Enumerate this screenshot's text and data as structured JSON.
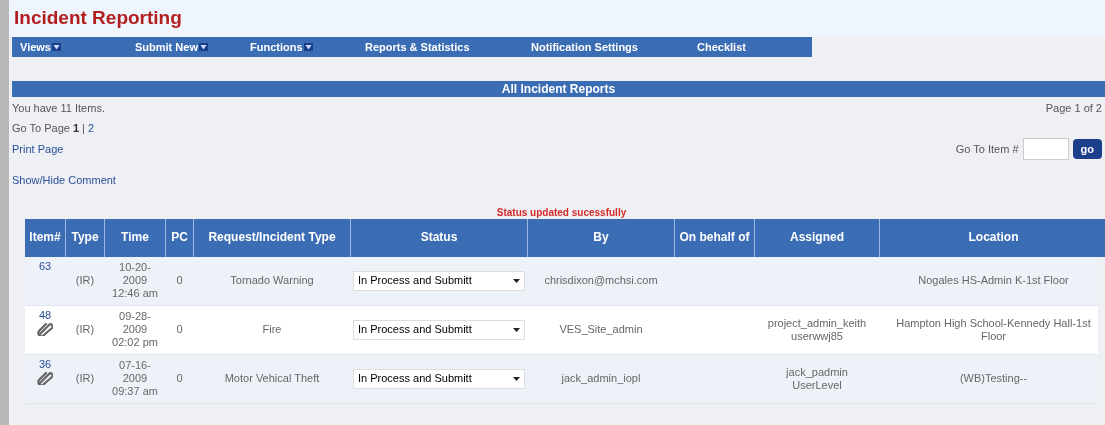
{
  "title": "Incident Reporting",
  "menu": [
    {
      "label": "Views",
      "dropdown": true
    },
    {
      "label": "Submit New",
      "dropdown": true
    },
    {
      "label": "Functions",
      "dropdown": true
    },
    {
      "label": "Reports & Statistics",
      "dropdown": false
    },
    {
      "label": "Notification Settings",
      "dropdown": false
    },
    {
      "label": "Checklist",
      "dropdown": false
    }
  ],
  "section_title": "All Incident Reports",
  "item_count": "You have 11 Items.",
  "page_info": "Page 1 of 2",
  "go_to_page": {
    "label": "Go To Page",
    "separator": "|",
    "pages": [
      {
        "label": "1",
        "selected": true
      },
      {
        "label": "2",
        "selected": false
      }
    ]
  },
  "print_page": "Print Page",
  "go_to_item": {
    "label": "Go To Item #",
    "button": "go"
  },
  "show_hide_comment": "Show/Hide Comment",
  "status_message": "Status updated sucessfully",
  "table": {
    "columns": [
      "Item#",
      "Type",
      "Time",
      "PC",
      "Request/Incident Type",
      "Status",
      "By",
      "On behalf of",
      "Assigned",
      "Location"
    ],
    "rows": [
      {
        "item": "63",
        "attachment": false,
        "type": "(IR)",
        "time": "10-20-2009 12:46 am",
        "pc": "0",
        "request_type": "Tornado Warning",
        "status": "In Process and Submitt",
        "by": "chrisdixon@mchsi.com",
        "location": "Nogales HS-Admin K-1st Floor"
      },
      {
        "item": "48",
        "attachment": true,
        "type": "(IR)",
        "time": "09-28-2009 02:02 pm",
        "pc": "0",
        "request_type": "Fire",
        "status": "In Process and Submitt",
        "by": "VES_Site_admin",
        "assigned": "project_admin_keith userwwj85",
        "location": "Hampton High School-Kennedy Hall-1st Floor"
      },
      {
        "item": "36",
        "attachment": true,
        "type": "(IR)",
        "time": "07-16-2009 09:37 am",
        "pc": "0",
        "request_type": "Motor Vehical Theft",
        "status": "In Process and Submitt",
        "by": "jack_admin_iopl",
        "assigned": "jack_padmin UserLevel",
        "location": "(WB)Testing--"
      }
    ]
  }
}
